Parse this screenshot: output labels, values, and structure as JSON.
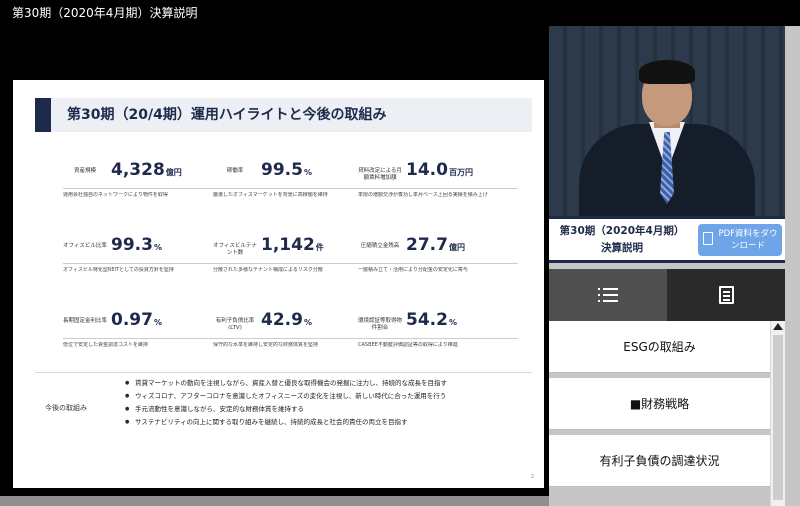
{
  "window": {
    "title": "第30期（2020年4月期）決算説明"
  },
  "slide": {
    "title": "第30期（20/4期）運用ハイライトと今後の取組み",
    "metrics": [
      {
        "label": "資産規模",
        "value": "4,328",
        "unit": "億円",
        "desc": "運用会社独自のネットワークにより物件を取得"
      },
      {
        "label": "稼働率",
        "value": "99.5",
        "unit": "%",
        "desc": "厳選したオフィスマーケットを背景に高稼働を維持"
      },
      {
        "label": "貸料改定による月額賃料増加額",
        "value": "14.0",
        "unit": "百万円",
        "desc": "単限の増額交渉が奏功し単月ベース上回る実績を積み上げ"
      },
      {
        "label": "オフィスビル比率",
        "value": "99.3",
        "unit": "%",
        "desc": "オフィスビル特化型REITとしての投資方針を堅持"
      },
      {
        "label": "オフィスビルテナント数",
        "value": "1,142",
        "unit": "件",
        "desc": "分散された多様なテナント構成によるリスク分散"
      },
      {
        "label": "圧縮積立金残高",
        "value": "27.7",
        "unit": "億円",
        "desc": "一層積み立て・活用により分配金の安定化に寄与"
      },
      {
        "label": "長期固定金利比率",
        "value": "0.97",
        "unit": "%",
        "desc": "低位で安定した資金調達コストを維持"
      },
      {
        "label": "有利子負債比率(LTV)",
        "value": "42.9",
        "unit": "%",
        "desc": "保守的な水準を維持し安定的な財務体質を堅持"
      },
      {
        "label": "環境認証等取得物件割合",
        "value": "54.2",
        "unit": "%",
        "desc": "CASBEE不動産評価認証等の取得により推進"
      }
    ],
    "future_label": "今後の取組み",
    "future_items": [
      "賃貸マーケットの動向を注視しながら、資産入替と優良な取得機会の発掘に注力し、持続的な成長を目指す",
      "ウィズコロナ、アフターコロナを意識したオフィスニーズの変化を注視し、新しい時代に合った運用を行う",
      "手元流動性を意識しながら、安定的な財務体質を維持する",
      "サステナビリティの向上に関する取り組みを継続し、持続的成長と社会的責任の両立を目指す"
    ],
    "page_number": "2"
  },
  "sidebar": {
    "period_label": "第30期（2020年4月期）決算説明",
    "pdf_button": "PDF資料をダウンロード",
    "tabs": [
      {
        "name": "list",
        "icon": "list-icon"
      },
      {
        "name": "document",
        "icon": "document-icon"
      }
    ],
    "toc": [
      "ESGの取組み",
      "■財務戦略",
      "有利子負債の調達状況"
    ]
  }
}
